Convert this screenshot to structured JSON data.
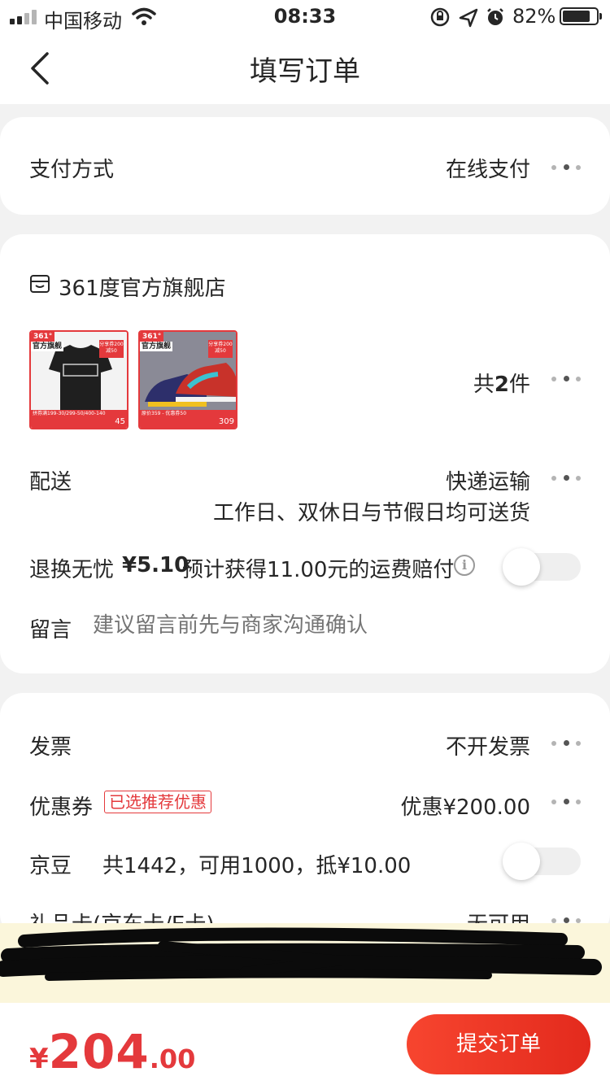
{
  "status_bar": {
    "carrier": "中国移动",
    "time": "08:33",
    "battery": "82%",
    "battery_level": 0.82
  },
  "nav": {
    "title": "填写订单"
  },
  "payment": {
    "label": "支付方式",
    "value": "在线支付"
  },
  "store": {
    "name": "361度官方旗舰店",
    "products": [
      {
        "brand_tag": "361°",
        "flag": "官方旗舰",
        "coupon": "分享券200减50",
        "footer": "拼券满199-30/299-50/400-140",
        "price": "45"
      },
      {
        "brand_tag": "361°",
        "flag": "官方旗舰",
        "coupon": "分享券200减50",
        "footer": "原价359 - 优惠券50",
        "price": "309"
      }
    ],
    "count_prefix": "共",
    "count": "2",
    "count_suffix": "件"
  },
  "delivery": {
    "label": "配送",
    "method": "快递运输",
    "note": "工作日、双休日与节假日均可送货"
  },
  "return_insurance": {
    "label": "退换无忧",
    "price": "¥5.10",
    "desc": "预计获得11.00元的运费赔付"
  },
  "message": {
    "label": "留言",
    "placeholder": "建议留言前先与商家沟通确认"
  },
  "invoice": {
    "label": "发票",
    "value": "不开发票"
  },
  "coupon": {
    "label": "优惠券",
    "tag": "已选推荐优惠",
    "value": "优惠¥200.00"
  },
  "jingdou": {
    "label": "京豆",
    "desc": "共1442，可用1000，抵¥10.00"
  },
  "gift_card": {
    "label": "礼品卡(京东卡/E卡)",
    "value": "无可用"
  },
  "bottom": {
    "currency": "¥",
    "price_int": "204",
    "price_dec": ".00",
    "submit": "提交订单"
  },
  "colors": {
    "accent": "#e4393c",
    "button": "#f33a24",
    "notice_bg": "#fbf6db"
  }
}
